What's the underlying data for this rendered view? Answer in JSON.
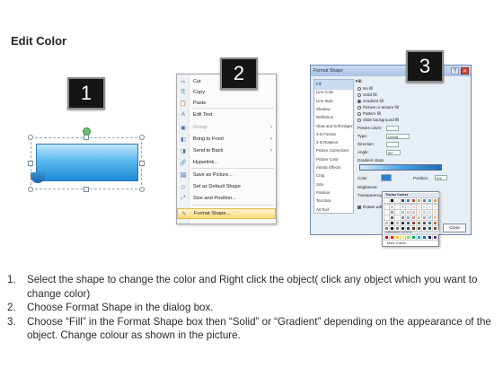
{
  "title": "Edit Color",
  "badges": [
    "1",
    "2",
    "3"
  ],
  "context_menu": {
    "items": [
      {
        "label": "Cut",
        "icon": "scissors-icon",
        "glyph": "✂"
      },
      {
        "label": "Copy",
        "icon": "copy-icon",
        "glyph": "⎘"
      },
      {
        "label": "Paste",
        "icon": "paste-icon",
        "glyph": "📋"
      },
      {
        "label": "Edit Text",
        "icon": "edit-text-icon",
        "glyph": "A"
      },
      {
        "label": "Group",
        "icon": "group-icon",
        "glyph": "▣",
        "submenu": true,
        "disabled": true
      },
      {
        "label": "Bring to Front",
        "icon": "bring-to-front-icon",
        "glyph": "◧",
        "submenu": true
      },
      {
        "label": "Send to Back",
        "icon": "send-to-back-icon",
        "glyph": "◨",
        "submenu": true
      },
      {
        "label": "Hyperlink...",
        "icon": "hyperlink-icon",
        "glyph": "🔗"
      },
      {
        "label": "Save as Picture...",
        "icon": "save-picture-icon",
        "glyph": "🖼"
      },
      {
        "label": "Set as Default Shape",
        "icon": "default-shape-icon",
        "glyph": "◇"
      },
      {
        "label": "Size and Position...",
        "icon": "size-position-icon",
        "glyph": "⤢"
      },
      {
        "label": "Format Shape...",
        "icon": "format-shape-icon",
        "glyph": "✎",
        "highlighted": true
      }
    ],
    "arrow": "›"
  },
  "dialog": {
    "title": "Format Shape",
    "help": "?",
    "close": "×",
    "categories": [
      "Fill",
      "Line Color",
      "Line Style",
      "Shadow",
      "Reflection",
      "Glow and Soft Edges",
      "3-D Format",
      "3-D Rotation",
      "Picture Corrections",
      "Picture Color",
      "Artistic Effects",
      "Crop",
      "Size",
      "Position",
      "Text Box",
      "Alt Text"
    ],
    "section": "Fill",
    "fill_options": [
      "No fill",
      "Solid fill",
      "Gradient fill",
      "Picture or texture fill",
      "Pattern fill",
      "Slide background fill"
    ],
    "selected_fill": "Gradient fill",
    "fields": {
      "preset": "Preset colors:",
      "type": "Type:",
      "type_value": "Linear",
      "direction": "Direction:",
      "angle": "Angle:",
      "angle_value": "90°",
      "gradient_stops": "Gradient stops",
      "color": "Color",
      "position": "Position:",
      "position_value": "0%",
      "brightness": "Brightness:",
      "transparency": "Transparency:",
      "rotate": "Rotate with shape"
    },
    "close_button": "Close",
    "theme_popup": {
      "theme_header": "Theme Colors",
      "standard_header": "Standard Colors",
      "more": "More Colors...",
      "theme_colors": [
        "#ffffff",
        "#000000",
        "#eeece1",
        "#1f497d",
        "#4f81bd",
        "#c0504d",
        "#9bbb59",
        "#8064a2",
        "#4bacc6",
        "#f79646"
      ],
      "standard_colors": [
        "#c00000",
        "#ff0000",
        "#ffc000",
        "#ffff00",
        "#92d050",
        "#00b050",
        "#00b0f0",
        "#0070c0",
        "#002060",
        "#7030a0"
      ]
    }
  },
  "steps": [
    {
      "num": "1.",
      "text": "Select the shape to change the color and Right click the object( click any object which you want to change color)"
    },
    {
      "num": "2.",
      "text": "Choose Format Shape in the dialog box."
    },
    {
      "num": "3.",
      "text": "Choose “Fill” in the Format Shape box then “Solid” or “Gradient” depending on the appearance of the object. Change colour as shown in the picture."
    }
  ]
}
